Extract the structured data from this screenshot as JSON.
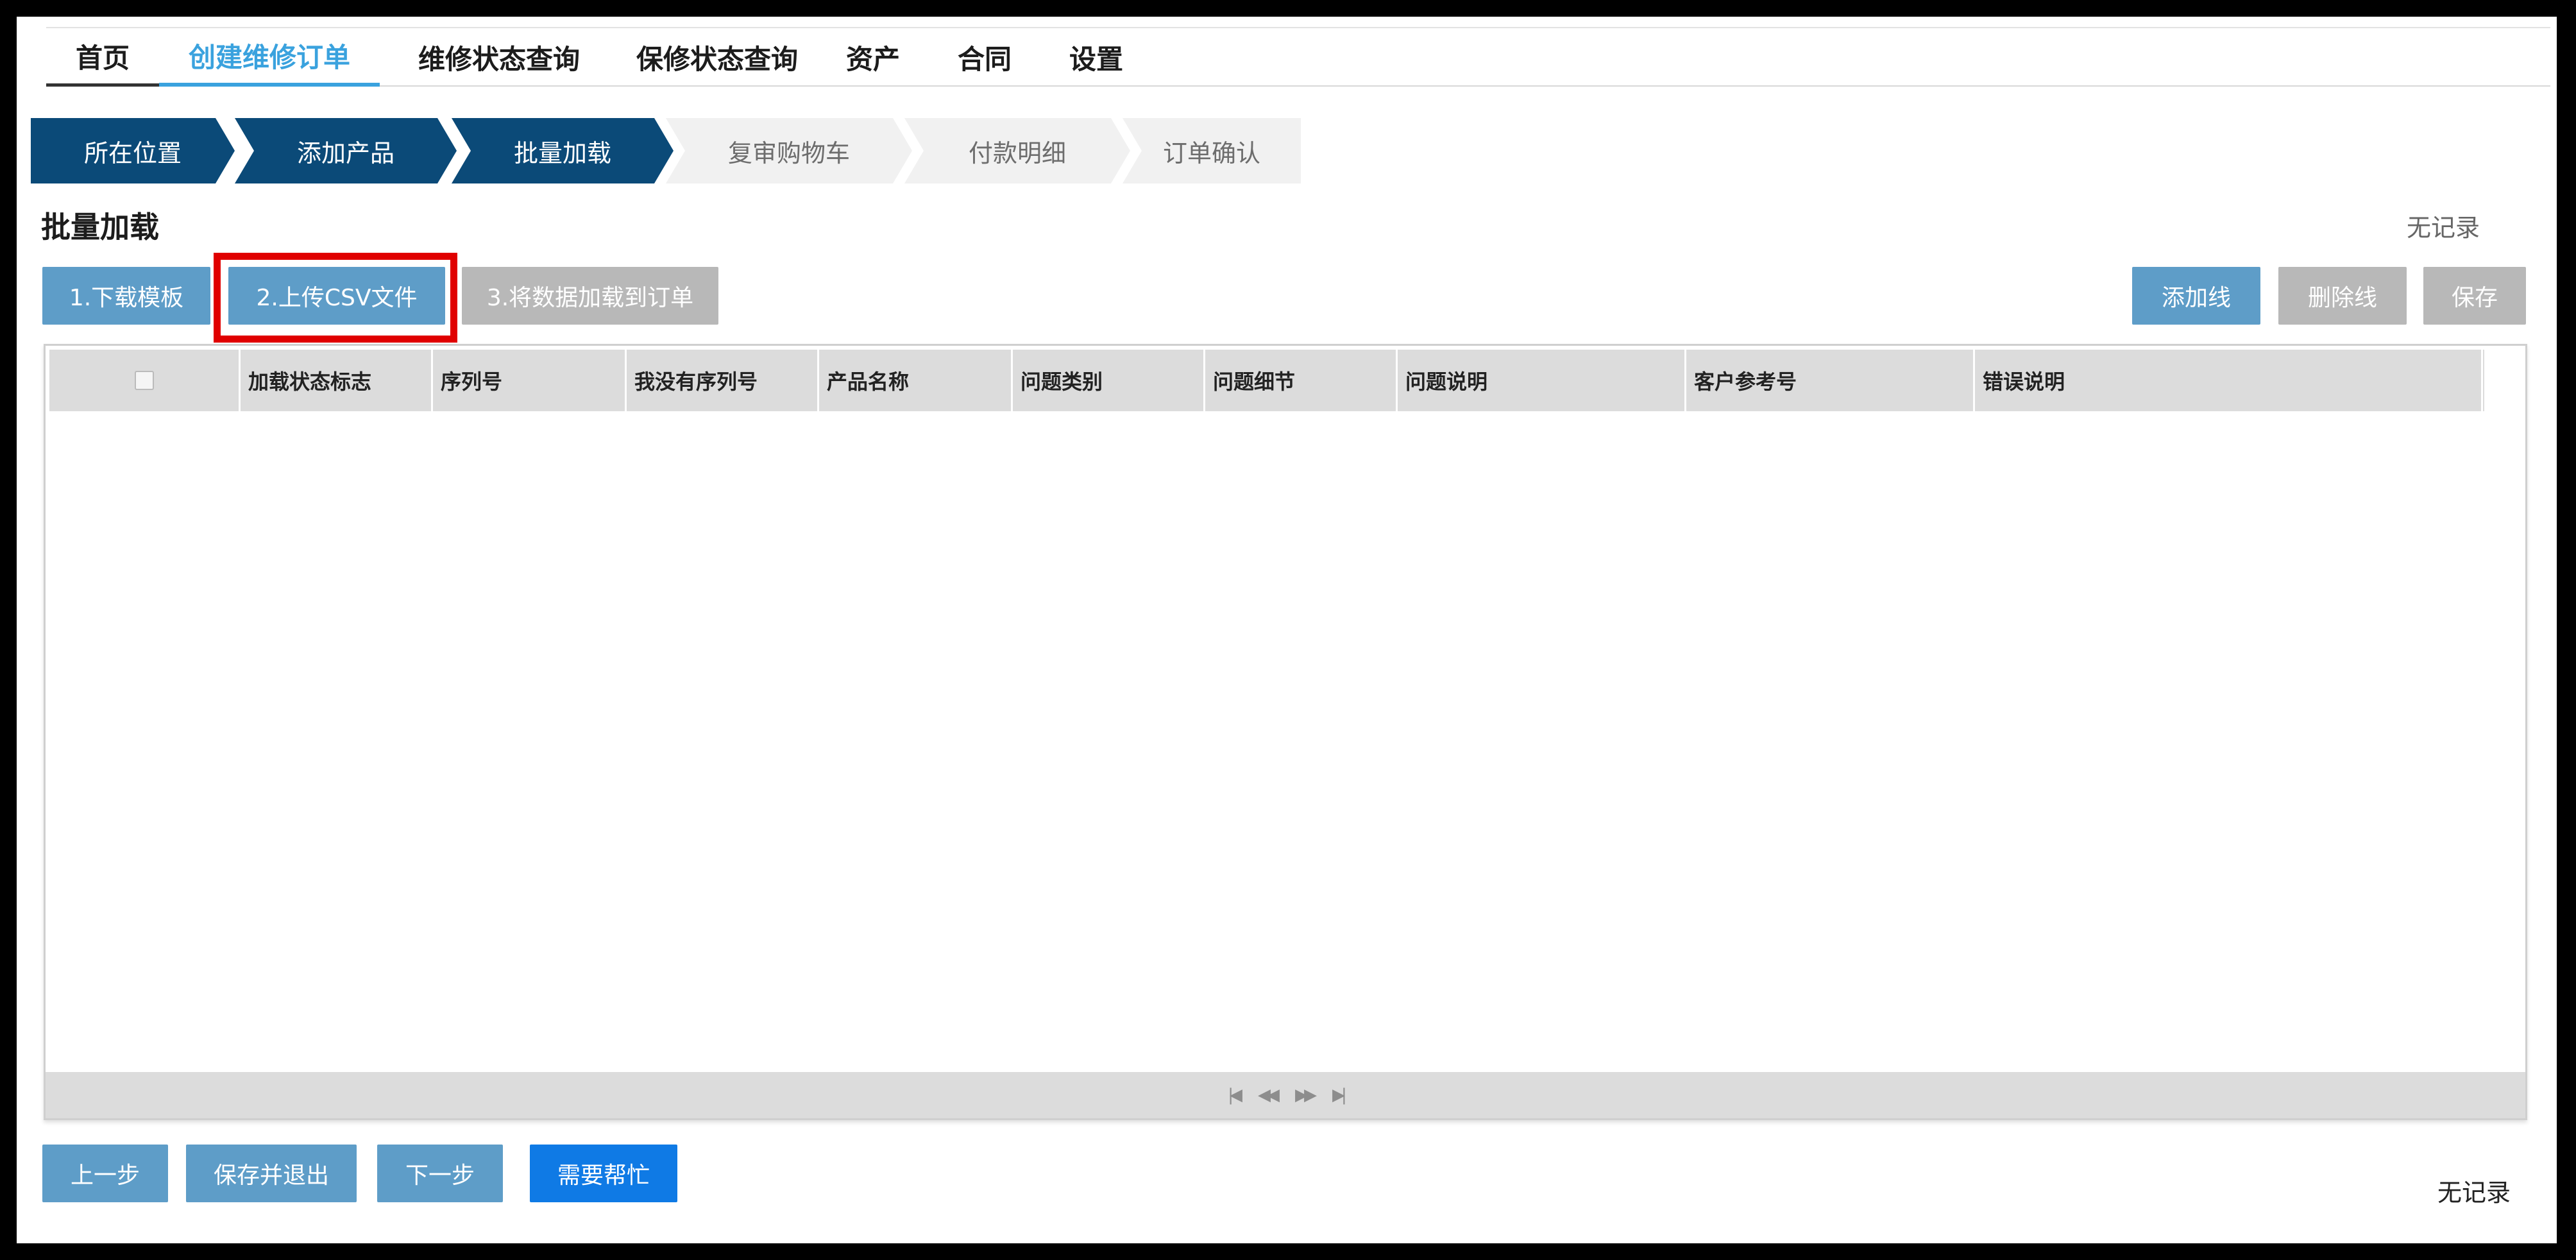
{
  "nav": {
    "items": [
      {
        "label": "首页"
      },
      {
        "label": "创建维修订单"
      },
      {
        "label": "维修状态查询"
      },
      {
        "label": "保修状态查询"
      },
      {
        "label": "资产"
      },
      {
        "label": "合同"
      },
      {
        "label": "设置"
      }
    ],
    "active_index": 1
  },
  "steps": [
    {
      "label": "所在位置",
      "state": "done"
    },
    {
      "label": "添加产品",
      "state": "done"
    },
    {
      "label": "批量加载",
      "state": "done"
    },
    {
      "label": "复审购物车",
      "state": "todo"
    },
    {
      "label": "付款明细",
      "state": "todo"
    },
    {
      "label": "订单确认",
      "state": "todo"
    }
  ],
  "section": {
    "title": "批量加载",
    "records": "无记录"
  },
  "actions": {
    "download_template": "1.下载模板",
    "upload_csv": "2.上传CSV文件",
    "load_to_order": "3.将数据加载到订单",
    "add_line": "添加线",
    "delete_line": "删除线",
    "save": "保存"
  },
  "table": {
    "columns": [
      "加载状态标志",
      "序列号",
      "我没有序列号",
      "产品名称",
      "问题类别",
      "问题细节",
      "问题说明",
      "客户参考号",
      "错误说明"
    ],
    "rows": []
  },
  "footer": {
    "prev": "上一步",
    "save_exit": "保存并退出",
    "next": "下一步",
    "help": "需要帮忙",
    "records": "无记录"
  },
  "colors": {
    "step_done": "#0b4a78",
    "step_todo": "#f1f1f1",
    "nav_active": "#3aa2de",
    "button_blue": "#5e9dc8",
    "button_gray": "#b8b8b8",
    "button_help": "#0f7ae5",
    "highlight": "#e00000"
  }
}
